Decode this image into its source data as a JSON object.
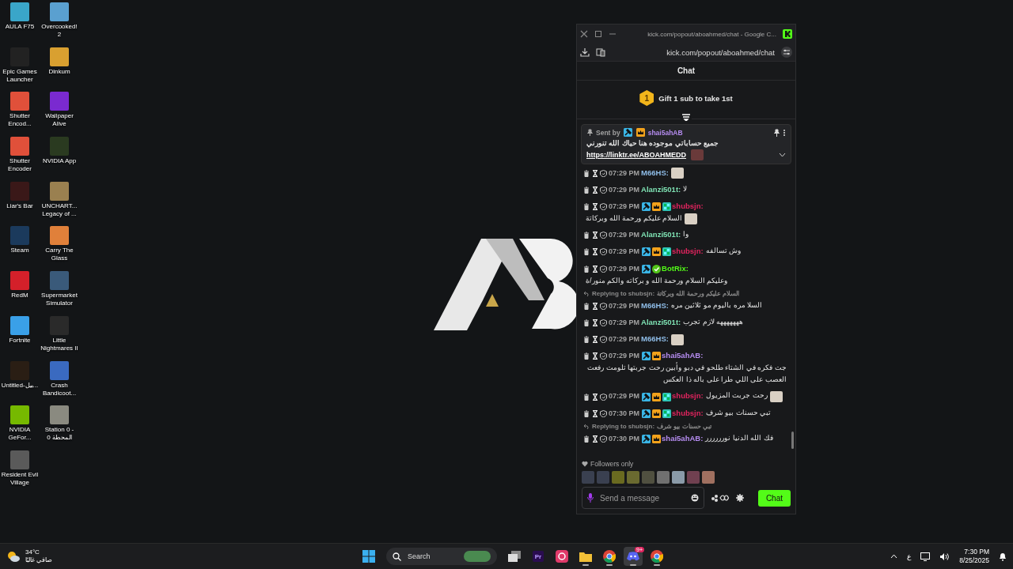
{
  "desktop": {
    "icons": [
      {
        "label": "AULA F75",
        "color": "#3aa6c9"
      },
      {
        "label": "Epic Games Launcher",
        "color": "#222222"
      },
      {
        "label": "Shutter Encod...",
        "color": "#e0503a"
      },
      {
        "label": "Shutter Encoder",
        "color": "#e0503a"
      },
      {
        "label": "Liar's Bar",
        "color": "#3a1818"
      },
      {
        "label": "Steam",
        "color": "#1b3a5c"
      },
      {
        "label": "RedM",
        "color": "#d4202a"
      },
      {
        "label": "Fortnite",
        "color": "#3aa0e8"
      },
      {
        "label": "Untitled-بيل...",
        "color": "#2a1e14"
      },
      {
        "label": "NVIDIA GeFor...",
        "color": "#76b900"
      },
      {
        "label": "Resident Evil Village",
        "color": "#5a5a5a"
      },
      {
        "label": "Overcooked! 2",
        "color": "#5aa0d0"
      },
      {
        "label": "Dinkum",
        "color": "#d9a030"
      },
      {
        "label": "Wallpaper Alive",
        "color": "#7a2ad0"
      },
      {
        "label": "NVIDIA App",
        "color": "#2a3a20"
      },
      {
        "label": "UNCHART... Legacy of ...",
        "color": "#9a8050"
      },
      {
        "label": "Carry The Glass",
        "color": "#e0803a"
      },
      {
        "label": "Supermarket Simulator",
        "color": "#3a5a7a"
      },
      {
        "label": "Little Nightmares II",
        "color": "#2a2a2a"
      },
      {
        "label": "Crash Bandicoot...",
        "color": "#3a6ac0"
      },
      {
        "label": "Station 0 - المحطة 0",
        "color": "#8a8a80"
      }
    ]
  },
  "chat_window": {
    "title": "kick.com/popout/aboahmed/chat - Google C...",
    "url": "kick.com/popout/aboahmed/chat",
    "header": "Chat",
    "leaderboard": {
      "rank": "1",
      "text": "Gift 1 sub to take 1st"
    },
    "pinned": {
      "sent_by": "Sent by",
      "badges": [
        {
          "kind": "mod"
        },
        {
          "kind": "crown"
        }
      ],
      "username": "shai5ahAB",
      "color": "#b58cf0",
      "text": "جميع حساباتي موجوده هنا حياك الله تنورني",
      "link": "https://linktr.ee/ABOAHMEDD"
    },
    "messages": [
      {
        "time": "07:29 PM",
        "username": "M66HS:",
        "color": "#8fbde8",
        "emote": true
      },
      {
        "time": "07:29 PM",
        "username": "Alanzi501t:",
        "color": "#7fe3b4",
        "text": "لا"
      },
      {
        "time": "07:29 PM",
        "badges": [
          {
            "kind": "mod"
          },
          {
            "kind": "crown"
          },
          {
            "kind": "sub"
          }
        ],
        "username": "shubsjn:",
        "color": "#e0245e",
        "text": "السلام عليكم ورحمة الله وبركاتة",
        "emote": true
      },
      {
        "time": "07:29 PM",
        "username": "Alanzi501t:",
        "color": "#7fe3b4",
        "text": "وا"
      },
      {
        "time": "07:29 PM",
        "badges": [
          {
            "kind": "mod"
          },
          {
            "kind": "crown"
          },
          {
            "kind": "sub"
          }
        ],
        "username": "shubsjn:",
        "color": "#e0245e",
        "text": "وش تسالفه"
      },
      {
        "time": "07:29 PM",
        "badges": [
          {
            "kind": "mod"
          },
          {
            "kind": "verified"
          }
        ],
        "username": "BotRix:",
        "color": "#53fc18",
        "text": "وعليكم السلام ورحمة الله و بركاته والكم منور/ة"
      },
      {
        "time": "07:29 PM",
        "username": "M66HS:",
        "color": "#8fbde8",
        "text": "السلا مره باليوم مو ثلاثين مره",
        "reply": {
          "label": "Replying to shubsjn:",
          "text": "السلام عليكم ورحمة الله وبركاتة"
        }
      },
      {
        "time": "07:29 PM",
        "username": "Alanzi501t:",
        "color": "#7fe3b4",
        "text": "هههههههه لازم تجرب"
      },
      {
        "time": "07:29 PM",
        "username": "M66HS:",
        "color": "#8fbde8",
        "emote": true
      },
      {
        "time": "07:29 PM",
        "badges": [
          {
            "kind": "mod"
          },
          {
            "kind": "crown"
          }
        ],
        "username": "shai5ahAB:",
        "color": "#b58cf0",
        "text": "جت فكره في الشتاء طلحو في دبو وأبين رحت جربتها تلومت رفعت العصب على اللي طرا على باله ذا العكس"
      },
      {
        "time": "07:29 PM",
        "badges": [
          {
            "kind": "mod"
          },
          {
            "kind": "crown"
          },
          {
            "kind": "sub"
          }
        ],
        "username": "shubsjn:",
        "color": "#e0245e",
        "text": "رحت جربت المزيول",
        "emote": true
      },
      {
        "time": "07:30 PM",
        "badges": [
          {
            "kind": "mod"
          },
          {
            "kind": "crown"
          },
          {
            "kind": "sub"
          }
        ],
        "username": "shubsjn:",
        "color": "#e0245e",
        "text": "تبي حسنات بيو شرف"
      },
      {
        "time": "07:30 PM",
        "badges": [
          {
            "kind": "mod"
          },
          {
            "kind": "crown"
          }
        ],
        "username": "shai5ahAB:",
        "color": "#b58cf0",
        "text": "فك الله الدنيا نورررررر",
        "reply": {
          "label": "Replying to shubsjn:",
          "text": "تبي حسنات بيو شرف"
        }
      }
    ],
    "followers_only": "Followers only",
    "input": {
      "placeholder": "Send a message"
    },
    "send_button": "Chat"
  },
  "taskbar": {
    "weather": {
      "temperature": "34°C",
      "condition": "صافي غالبًا"
    },
    "search": {
      "placeholder": "Search"
    },
    "apps": [
      {
        "kind": "windows",
        "running": false,
        "selected": false
      },
      {
        "kind": "taskview",
        "running": false,
        "selected": false
      },
      {
        "kind": "premiere",
        "label": "Pr",
        "running": false,
        "selected": false
      },
      {
        "kind": "creative",
        "running": false,
        "selected": false
      },
      {
        "kind": "folder",
        "running": true,
        "selected": false
      },
      {
        "kind": "chrome",
        "running": true,
        "selected": false
      },
      {
        "kind": "discord",
        "label": "9+",
        "running": true,
        "selected": true
      },
      {
        "kind": "chrome",
        "running": true,
        "selected": false
      }
    ],
    "language": "ع",
    "time": "7:30 PM",
    "date": "8/25/2025"
  }
}
